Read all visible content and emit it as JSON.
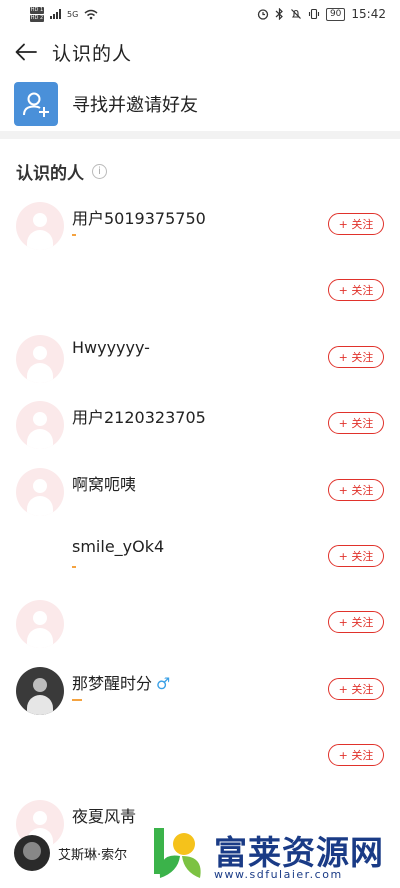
{
  "status_bar": {
    "sim1": "HD 1",
    "sim2": "HD 2",
    "network": "5G",
    "battery": "90",
    "time": "15:42"
  },
  "header": {
    "title": "认识的人",
    "back_icon": "arrow-left-icon"
  },
  "invite": {
    "label": "寻找并邀请好友",
    "icon": "add-person-icon",
    "icon_bg": "#4a90d9"
  },
  "section": {
    "title": "认识的人",
    "info_glyph": "i"
  },
  "follow_label": "+ 关注",
  "accent": "#e0322b",
  "people": [
    {
      "name": "用户5019375750"
    },
    {
      "name": ""
    },
    {
      "name": "Hwyyyyy-"
    },
    {
      "name": "用户2120323705"
    },
    {
      "name": "啊窝呃咦"
    },
    {
      "name": "smile_yOk4"
    },
    {
      "name": ""
    },
    {
      "name": "那梦醒时分",
      "gender": "♂"
    },
    {
      "name": ""
    },
    {
      "name": "夜夏风靑"
    }
  ],
  "bottom_user": {
    "name": "艾斯琳·索尔"
  },
  "watermark": {
    "text": "富莱资源网",
    "url": "www.sdfulaier.com"
  }
}
